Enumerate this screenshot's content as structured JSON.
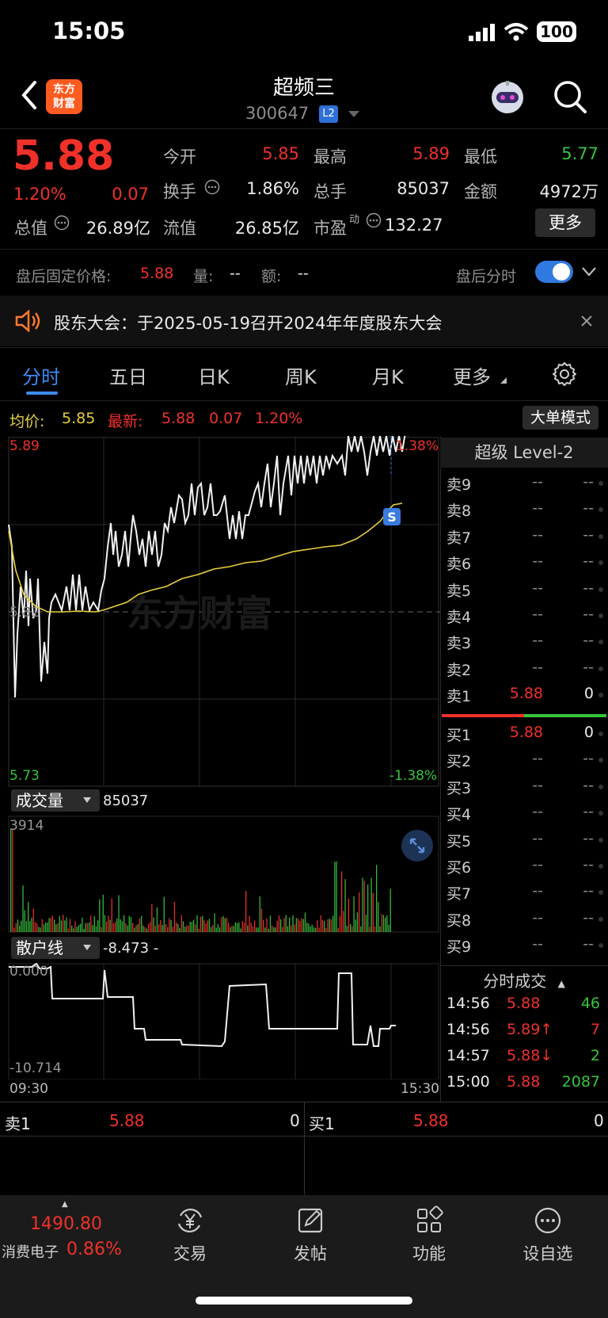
{
  "status": {
    "time": "15:05",
    "battery": "100"
  },
  "header": {
    "logo_line1": "东方",
    "logo_line2": "财富",
    "stock_name": "超频三",
    "stock_code": "300647",
    "level_badge": "L2"
  },
  "quote": {
    "price": "5.88",
    "change_pct": "1.20%",
    "change": "0.07",
    "open_label": "今开",
    "open": "5.85",
    "high_label": "最高",
    "high": "5.89",
    "low_label": "最低",
    "low": "5.77",
    "turnover_label": "换手",
    "turnover": "1.86%",
    "volume_label": "总手",
    "volume": "85037",
    "amount_label": "金额",
    "amount": "4972万",
    "mktcap_label": "总值",
    "mktcap": "26.89亿",
    "float_label": "流值",
    "float_cap": "26.85亿",
    "pe_label": "市盈",
    "pe_sup": "动",
    "pe": "132.27",
    "more_button": "更多"
  },
  "after_hours": {
    "price_label": "盘后固定价格:",
    "price": "5.88",
    "vol_label": "量:",
    "vol": "--",
    "amt_label": "额:",
    "amt": "--",
    "timeshare_label": "盘后分时"
  },
  "notice": {
    "text": "股东大会：于2025-05-19召开2024年年度股东大会"
  },
  "tabs": [
    "分时",
    "五日",
    "日K",
    "周K",
    "月K",
    "更多"
  ],
  "legend": {
    "avg_label": "均价:",
    "avg": "5.85",
    "latest_label": "最新:",
    "latest": "5.88",
    "chg": "0.07",
    "chg_pct": "1.20%",
    "big_order_button": "大单模式"
  },
  "main_chart": {
    "y_top": "5.89",
    "y_mid": "5.81",
    "y_bottom": "5.73",
    "pct_top": "1.38%",
    "pct_bottom": "-1.38%",
    "watermark": "东方财富",
    "s_marker": "S"
  },
  "volume_chart": {
    "label": "成交量",
    "value": "85037",
    "max": "3914"
  },
  "retail_chart": {
    "label": "散户线",
    "value": "-8.473 -",
    "top": "0.000",
    "bottom": "-10.714",
    "x_start": "09:30",
    "x_end": "15:30"
  },
  "level2": {
    "title": "超级 Level-2",
    "asks": [
      {
        "label": "卖9",
        "price": "--",
        "vol": "--"
      },
      {
        "label": "卖8",
        "price": "--",
        "vol": "--"
      },
      {
        "label": "卖7",
        "price": "--",
        "vol": "--"
      },
      {
        "label": "卖6",
        "price": "--",
        "vol": "--"
      },
      {
        "label": "卖5",
        "price": "--",
        "vol": "--"
      },
      {
        "label": "卖4",
        "price": "--",
        "vol": "--"
      },
      {
        "label": "卖3",
        "price": "--",
        "vol": "--"
      },
      {
        "label": "卖2",
        "price": "--",
        "vol": "--"
      },
      {
        "label": "卖1",
        "price": "5.88",
        "vol": "0"
      }
    ],
    "bids": [
      {
        "label": "买1",
        "price": "5.88",
        "vol": "0"
      },
      {
        "label": "买2",
        "price": "--",
        "vol": "--"
      },
      {
        "label": "买3",
        "price": "--",
        "vol": "--"
      },
      {
        "label": "买4",
        "price": "--",
        "vol": "--"
      },
      {
        "label": "买5",
        "price": "--",
        "vol": "--"
      },
      {
        "label": "买6",
        "price": "--",
        "vol": "--"
      },
      {
        "label": "买7",
        "price": "--",
        "vol": "--"
      },
      {
        "label": "买8",
        "price": "--",
        "vol": "--"
      },
      {
        "label": "买9",
        "price": "--",
        "vol": "--"
      }
    ],
    "trades_title": "分时成交",
    "trades": [
      {
        "time": "14:56",
        "price": "5.88",
        "vol": "46",
        "dir": ""
      },
      {
        "time": "14:56",
        "price": "5.89↑",
        "vol": "7",
        "dir": "up"
      },
      {
        "time": "14:57",
        "price": "5.88↓",
        "vol": "2",
        "dir": "down"
      },
      {
        "time": "15:00",
        "price": "5.88",
        "vol": "2087",
        "dir": ""
      }
    ]
  },
  "bottom_quote": {
    "sell_label": "卖1",
    "sell_price": "5.88",
    "sell_vol": "0",
    "buy_label": "买1",
    "buy_price": "5.88",
    "buy_vol": "0"
  },
  "bottom_nav": {
    "index_value": "1490.80",
    "index_name": "消费电子",
    "index_pct": "0.86%",
    "items": [
      "交易",
      "发帖",
      "功能",
      "设自选"
    ]
  }
}
